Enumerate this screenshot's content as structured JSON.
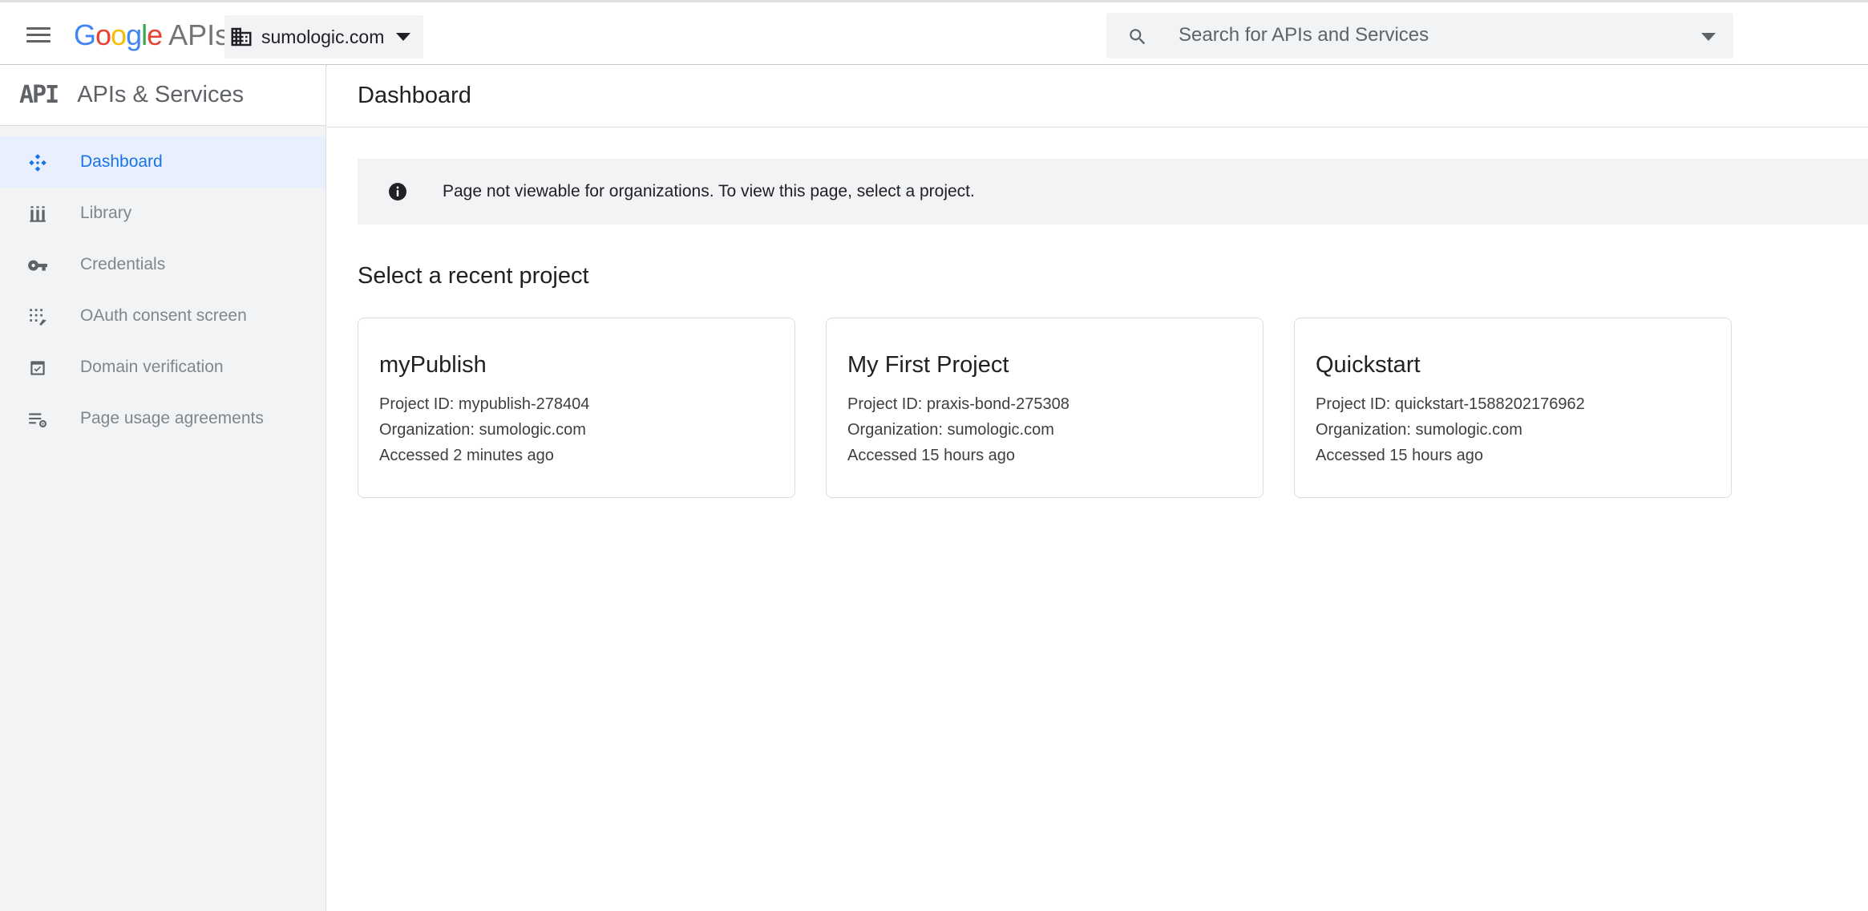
{
  "header": {
    "logo": {
      "G": "G",
      "o1": "o",
      "o2": "o",
      "g": "g",
      "l": "l",
      "e": "e",
      "apis": "APIs"
    },
    "org_name": "sumologic.com",
    "search": {
      "placeholder": "Search for APIs and Services",
      "value": ""
    }
  },
  "sidebar": {
    "badge": "API",
    "title": "APIs & Services",
    "items": [
      {
        "label": "Dashboard",
        "icon": "dashboard-icon",
        "active": true
      },
      {
        "label": "Library",
        "icon": "library-icon",
        "active": false
      },
      {
        "label": "Credentials",
        "icon": "key-icon",
        "active": false
      },
      {
        "label": "OAuth consent screen",
        "icon": "oauth-consent-icon",
        "active": false
      },
      {
        "label": "Domain verification",
        "icon": "domain-verification-icon",
        "active": false
      },
      {
        "label": "Page usage agreements",
        "icon": "settings-list-icon",
        "active": false
      }
    ]
  },
  "main": {
    "title": "Dashboard",
    "banner_text": "Page not viewable for organizations. To view this page, select a project.",
    "section_title": "Select a recent project",
    "projects": [
      {
        "name": "myPublish",
        "project_id": "Project ID: mypublish-278404",
        "organization": "Organization: sumologic.com",
        "accessed": "Accessed 2 minutes ago"
      },
      {
        "name": "My First Project",
        "project_id": "Project ID: praxis-bond-275308",
        "organization": "Organization: sumologic.com",
        "accessed": "Accessed 15 hours ago"
      },
      {
        "name": "Quickstart",
        "project_id": "Project ID: quickstart-1588202176962",
        "organization": "Organization: sumologic.com",
        "accessed": "Accessed 15 hours ago"
      }
    ]
  },
  "colors": {
    "accent": "#1a73e8",
    "active_bg": "#e8f0fe",
    "sidebar_bg": "#f1f3f4",
    "google_blue": "#4285f4",
    "google_red": "#ea4335",
    "google_yellow": "#fbbc05",
    "google_green": "#34a853"
  }
}
